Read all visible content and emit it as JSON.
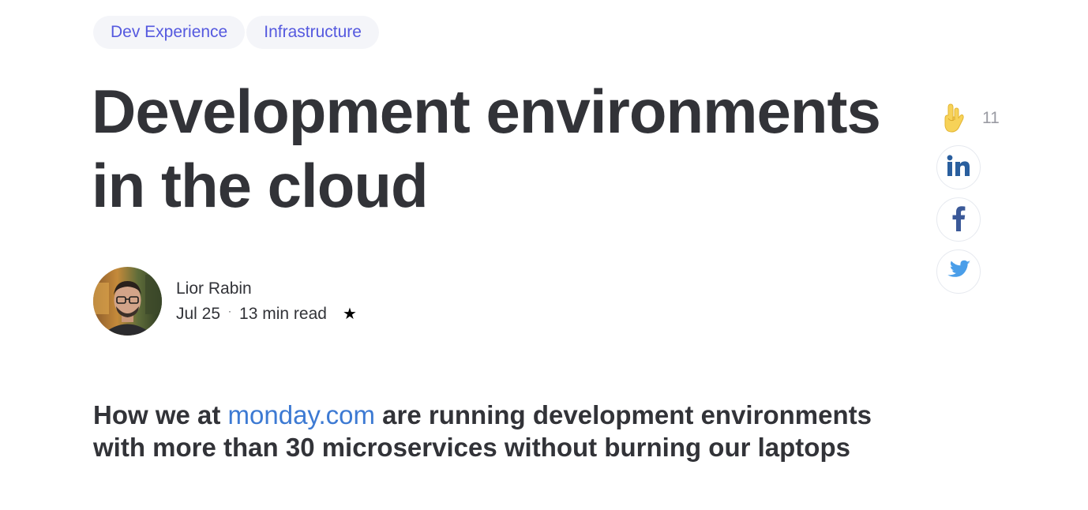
{
  "tags": [
    {
      "label": "Dev Experience"
    },
    {
      "label": "Infrastructure"
    }
  ],
  "article": {
    "title_line1": "Development environments",
    "title_line2": "in the cloud",
    "subtitle_prefix": "How we at",
    "subtitle_link": "monday.com",
    "subtitle_suffix": "are running development environments with more than 30 microservices without burning our laptops"
  },
  "author": {
    "name": "Lior Rabin",
    "date": "Jul 25",
    "separator": "·",
    "read_time": "13 min read",
    "star": "★"
  },
  "side": {
    "clap_count": "11",
    "share": [
      {
        "icon": "linkedin-icon",
        "color": "#2a5f9e"
      },
      {
        "icon": "facebook-icon",
        "color": "#3b5998"
      },
      {
        "icon": "twitter-icon",
        "color": "#4a9ee9"
      }
    ]
  },
  "colors": {
    "text": "#323338",
    "tag_bg": "#f4f5f9",
    "tag_text": "#5559df",
    "link": "#3d7ad3",
    "muted": "#9a9ba3"
  }
}
